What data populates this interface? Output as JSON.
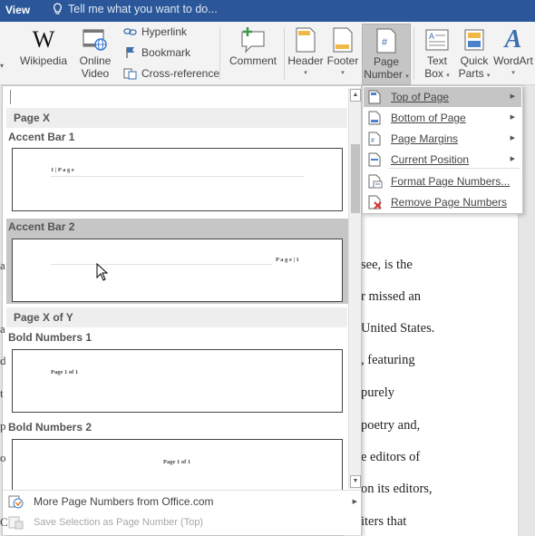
{
  "topbar": {
    "view_label": "View",
    "tell_me_placeholder": "Tell me what you want to do..."
  },
  "ribbon": {
    "wikipedia": "Wikipedia",
    "online_video": [
      "Online",
      "Video"
    ],
    "hyperlink": "Hyperlink",
    "bookmark": "Bookmark",
    "cross_reference": "Cross-reference",
    "comment": "Comment",
    "header": "Header",
    "footer": "Footer",
    "page_number": [
      "Page",
      "Number"
    ],
    "text_box": [
      "Text",
      "Box"
    ],
    "quick_parts": [
      "Quick",
      "Parts"
    ],
    "wordart": "WordArt"
  },
  "gallery": {
    "categories": {
      "page_x": "Page X",
      "page_x_of_y": "Page X of Y"
    },
    "items": {
      "accent_bar_1": {
        "label": "Accent Bar 1",
        "preview": "1 | P a g e"
      },
      "accent_bar_2": {
        "label": "Accent Bar 2",
        "preview": "P a g e  | 1"
      },
      "bold_numbers_1": {
        "label": "Bold Numbers 1",
        "preview": "Page 1 of 1"
      },
      "bold_numbers_2": {
        "label": "Bold Numbers 2",
        "preview": "Page 1 of 1"
      }
    },
    "footer": {
      "more_numbers": "More Page Numbers from Office.com",
      "save_selection": "Save Selection as Page Number (Top)"
    }
  },
  "page_number_menu": {
    "top_of_page": "Top of Page",
    "bottom_of_page": "Bottom of Page",
    "page_margins": "Page Margins",
    "current_position": "Current Position",
    "format_page_numbers": "Format Page Numbers...",
    "remove_page_numbers": "Remove Page Numbers"
  },
  "document": {
    "lines": [
      "see, is the",
      "r missed an",
      "United States.",
      ", featuring",
      "purely",
      "poetry and,",
      "e editors of",
      "on its editors,",
      "iters that"
    ],
    "left_fragments": [
      "a",
      "a",
      "d",
      "t",
      "p",
      "o",
      "C"
    ]
  },
  "colors": {
    "title_bar": "#2b579a",
    "menu_hover": "#c5c5c5",
    "selected_item": "#c6c6c6"
  }
}
